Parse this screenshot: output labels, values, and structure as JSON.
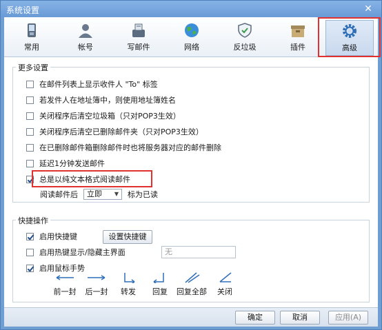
{
  "window": {
    "title": "系统设置"
  },
  "toolbar": {
    "tabs": [
      {
        "label": "常用",
        "icon": "phone-icon"
      },
      {
        "label": "帐号",
        "icon": "user-icon"
      },
      {
        "label": "写邮件",
        "icon": "compose-icon"
      },
      {
        "label": "网络",
        "icon": "globe-icon"
      },
      {
        "label": "反垃圾",
        "icon": "shield-icon"
      },
      {
        "label": "插件",
        "icon": "box-icon"
      },
      {
        "label": "高级",
        "icon": "gear-icon",
        "active": true
      }
    ]
  },
  "more": {
    "title": "更多设置",
    "options": [
      {
        "label": "在邮件列表上显示收件人 \"To\" 标签",
        "checked": false
      },
      {
        "label": "若发件人在地址簿中，则使用地址簿姓名",
        "checked": false
      },
      {
        "label": "关闭程序后清空垃圾箱（只对POP3生效）",
        "checked": false
      },
      {
        "label": "关闭程序后清空已删除邮件夹（只对POP3生效）",
        "checked": false
      },
      {
        "label": "在已删除邮件箱删除邮件时也将服务器对应的邮件删除",
        "checked": false
      },
      {
        "label": "延迟1分钟发送邮件",
        "checked": false
      },
      {
        "label": "总是以纯文本格式阅读邮件",
        "checked": true
      }
    ],
    "read_after": {
      "prefix": "阅读邮件后",
      "value": "立即",
      "suffix": "标为已读"
    }
  },
  "quick": {
    "title": "快捷操作",
    "enable_hotkeys": {
      "label": "启用快捷键",
      "checked": true
    },
    "set_hotkeys_button": "设置快捷键",
    "hotkey_toggle": {
      "label": "启用热键显示/隐藏主界面",
      "checked": false,
      "value": "无"
    },
    "mouse_gestures": {
      "label": "启用鼠标手势",
      "checked": true
    },
    "gestures": [
      {
        "label": "前一封"
      },
      {
        "label": "后一封"
      },
      {
        "label": "转发"
      },
      {
        "label": "回复"
      },
      {
        "label": "回复全部"
      },
      {
        "label": "关闭"
      }
    ]
  },
  "footer": {
    "ok": "确定",
    "cancel": "取消",
    "apply": "应用(A)"
  },
  "colors": {
    "accent": "#6f9ed3",
    "highlight": "#e03030",
    "check": "#1f4e8c"
  }
}
